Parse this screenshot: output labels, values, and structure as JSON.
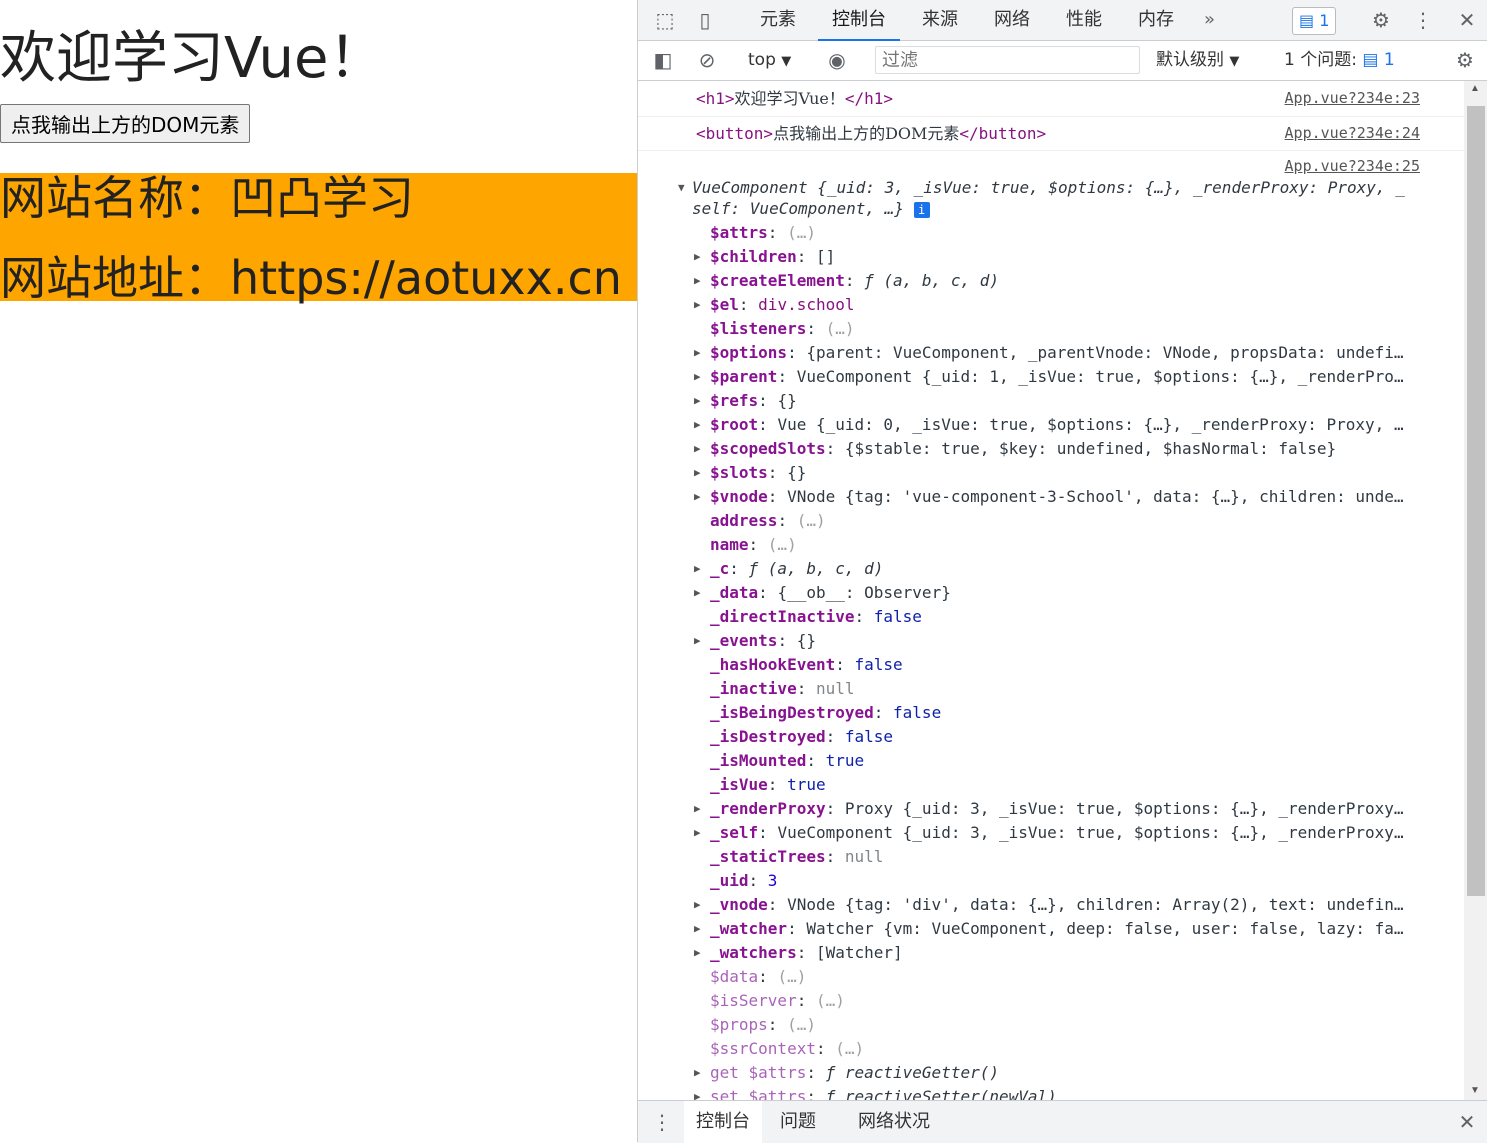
{
  "page": {
    "heading": "欢迎学习Vue！",
    "button_label": "点我输出上方的DOM元素",
    "school_name": "网站名称：凹凸学习",
    "school_address": "网站地址：https://aotuxx.cn",
    "school_bg": "#ffa500"
  },
  "devtools": {
    "tabs": [
      "元素",
      "控制台",
      "来源",
      "网络",
      "性能",
      "内存"
    ],
    "active_tab": "控制台",
    "more_tabs": "»",
    "issue_count": "1",
    "toolbar": {
      "context": "top",
      "filter_placeholder": "过滤",
      "level": "默认级别",
      "issues_label": "1 个问题:",
      "issues_count": "1"
    },
    "console": {
      "msg1": {
        "open": "<h1>",
        "text": "欢迎学习Vue！",
        "close": "</h1>",
        "source": "App.vue?234e:23"
      },
      "msg2": {
        "open": "<button>",
        "text": "点我输出上方的DOM元素",
        "close": "</button>",
        "source": "App.vue?234e:24"
      },
      "msg3_source": "App.vue?234e:25",
      "summary_line1": "VueComponent {_uid: 3, _isVue: true, $options: {…}, _renderProxy: Proxy, _",
      "summary_line2": "self: VueComponent, …}",
      "props": [
        {
          "key": "$attrs",
          "val": "(…)",
          "exp": false,
          "dim": false,
          "cls": "sep"
        },
        {
          "key": "$children",
          "val": "[]",
          "exp": true,
          "dim": false,
          "cls": ""
        },
        {
          "key": "$createElement",
          "val": "ƒ (a, b, c, d)",
          "exp": true,
          "dim": false,
          "cls": "it"
        },
        {
          "key": "$el",
          "val": "div.school",
          "exp": true,
          "dim": false,
          "cls": "tag"
        },
        {
          "key": "$listeners",
          "val": "(…)",
          "exp": false,
          "dim": false,
          "cls": "sep"
        },
        {
          "key": "$options",
          "val": "{parent: VueComponent, _parentVnode: VNode, propsData: undefi…",
          "exp": true,
          "dim": false,
          "cls": ""
        },
        {
          "key": "$parent",
          "val": "VueComponent {_uid: 1, _isVue: true, $options: {…}, _renderPro…",
          "exp": true,
          "dim": false,
          "cls": ""
        },
        {
          "key": "$refs",
          "val": "{}",
          "exp": true,
          "dim": false,
          "cls": ""
        },
        {
          "key": "$root",
          "val": "Vue {_uid: 0, _isVue: true, $options: {…}, _renderProxy: Proxy, …",
          "exp": true,
          "dim": false,
          "cls": ""
        },
        {
          "key": "$scopedSlots",
          "val": "{$stable: true, $key: undefined, $hasNormal: false}",
          "exp": true,
          "dim": false,
          "cls": ""
        },
        {
          "key": "$slots",
          "val": "{}",
          "exp": true,
          "dim": false,
          "cls": ""
        },
        {
          "key": "$vnode",
          "val": "VNode {tag: 'vue-component-3-School', data: {…}, children: unde…",
          "exp": true,
          "dim": false,
          "cls": ""
        },
        {
          "key": "address",
          "val": "(…)",
          "exp": false,
          "dim": false,
          "cls": "sep"
        },
        {
          "key": "name",
          "val": "(…)",
          "exp": false,
          "dim": false,
          "cls": "sep"
        },
        {
          "key": "_c",
          "val": "ƒ (a, b, c, d)",
          "exp": true,
          "dim": false,
          "cls": "it"
        },
        {
          "key": "_data",
          "val": "{__ob__: Observer}",
          "exp": true,
          "dim": false,
          "cls": ""
        },
        {
          "key": "_directInactive",
          "val": "false",
          "exp": false,
          "dim": false,
          "cls": "vb"
        },
        {
          "key": "_events",
          "val": "{}",
          "exp": true,
          "dim": false,
          "cls": ""
        },
        {
          "key": "_hasHookEvent",
          "val": "false",
          "exp": false,
          "dim": false,
          "cls": "vb"
        },
        {
          "key": "_inactive",
          "val": "null",
          "exp": false,
          "dim": false,
          "cls": "vnull"
        },
        {
          "key": "_isBeingDestroyed",
          "val": "false",
          "exp": false,
          "dim": false,
          "cls": "vb"
        },
        {
          "key": "_isDestroyed",
          "val": "false",
          "exp": false,
          "dim": false,
          "cls": "vb"
        },
        {
          "key": "_isMounted",
          "val": "true",
          "exp": false,
          "dim": false,
          "cls": "vb"
        },
        {
          "key": "_isVue",
          "val": "true",
          "exp": false,
          "dim": false,
          "cls": "vb"
        },
        {
          "key": "_renderProxy",
          "val": "Proxy {_uid: 3, _isVue: true, $options: {…}, _renderProxy…",
          "exp": true,
          "dim": false,
          "cls": ""
        },
        {
          "key": "_self",
          "val": "VueComponent {_uid: 3, _isVue: true, $options: {…}, _renderProxy…",
          "exp": true,
          "dim": false,
          "cls": ""
        },
        {
          "key": "_staticTrees",
          "val": "null",
          "exp": false,
          "dim": false,
          "cls": "vnull"
        },
        {
          "key": "_uid",
          "val": "3",
          "exp": false,
          "dim": false,
          "cls": "vn"
        },
        {
          "key": "_vnode",
          "val": "VNode {tag: 'div', data: {…}, children: Array(2), text: undefin…",
          "exp": true,
          "dim": false,
          "cls": ""
        },
        {
          "key": "_watcher",
          "val": "Watcher {vm: VueComponent, deep: false, user: false, lazy: fa…",
          "exp": true,
          "dim": false,
          "cls": ""
        },
        {
          "key": "_watchers",
          "val": "[Watcher]",
          "exp": true,
          "dim": false,
          "cls": ""
        },
        {
          "key": "$data",
          "val": "(…)",
          "exp": false,
          "dim": true,
          "cls": "sep"
        },
        {
          "key": "$isServer",
          "val": "(…)",
          "exp": false,
          "dim": true,
          "cls": "sep"
        },
        {
          "key": "$props",
          "val": "(…)",
          "exp": false,
          "dim": true,
          "cls": "sep"
        },
        {
          "key": "$ssrContext",
          "val": "(…)",
          "exp": false,
          "dim": true,
          "cls": "sep"
        },
        {
          "key": "get $attrs",
          "val": "ƒ reactiveGetter()",
          "exp": true,
          "dim": true,
          "cls": "it"
        },
        {
          "key": "set $attrs",
          "val": "ƒ reactiveSetter(newVal)",
          "exp": true,
          "dim": true,
          "cls": "it"
        }
      ]
    },
    "drawer_tabs": [
      "控制台",
      "问题",
      "网络状况"
    ]
  }
}
